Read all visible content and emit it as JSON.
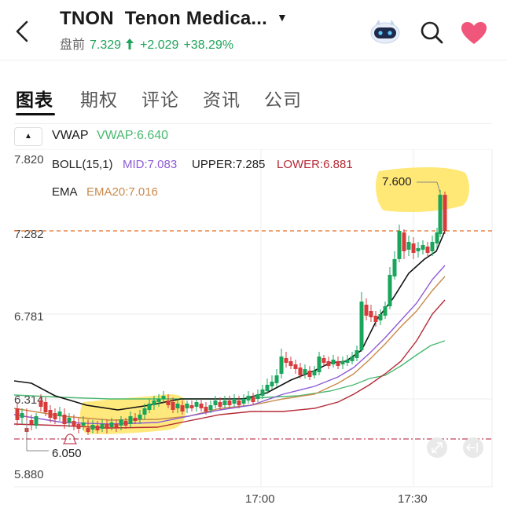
{
  "header": {
    "symbol": "TNON",
    "name": "Tenon Medica...",
    "session_label": "盘前",
    "price": "7.329",
    "change": "+2.029",
    "change_pct": "+38.29%"
  },
  "tabs": [
    {
      "label": "图表",
      "active": true
    },
    {
      "label": "期权"
    },
    {
      "label": "评论"
    },
    {
      "label": "资讯"
    },
    {
      "label": "公司"
    }
  ],
  "indicators": {
    "vwap_label": "VWAP",
    "vwap_value": "VWAP:6.640",
    "boll_label": "BOLL(15,1)",
    "boll_mid": "MID:7.083",
    "boll_upper": "UPPER:7.285",
    "boll_lower": "LOWER:6.881",
    "ema_label": "EMA",
    "ema_value": "EMA20:7.016"
  },
  "chart_data": {
    "type": "candlestick",
    "y_ticks": [
      "7.820",
      "7.282",
      "6.781",
      "6.314",
      "5.880"
    ],
    "x_ticks": [
      "17:00",
      "17:30"
    ],
    "ylim": [
      5.88,
      7.82
    ],
    "current_price_line": 7.282,
    "high_label": "7.600",
    "low_label": "6.050",
    "colors": {
      "up": "#1aa55c",
      "down": "#d83b3b",
      "vwap": "#111111",
      "mid": "#8e5bd6",
      "upper": "#c98a4a",
      "lower": "#b52a36",
      "ema": "#49b86f",
      "highlight": "#ffe566"
    }
  }
}
